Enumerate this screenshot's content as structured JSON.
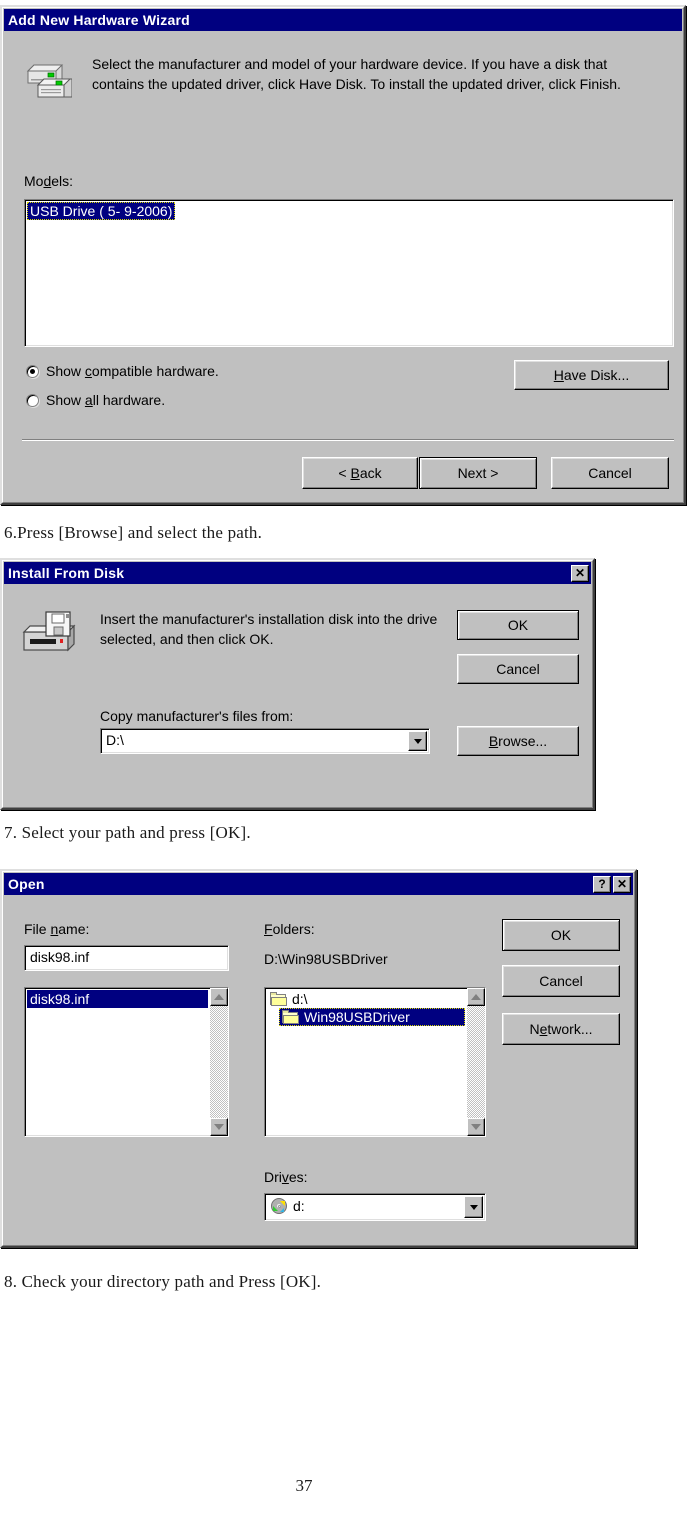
{
  "page": {
    "number": "37"
  },
  "steps": {
    "step6": "6.Press [Browse] and select the path.",
    "step7": "7. Select your path and press [OK].",
    "step8": "8. Check your directory path and Press [OK]."
  },
  "wizard": {
    "title": "Add New Hardware Wizard",
    "icon": "hardware-devices-icon",
    "instruction": "Select the manufacturer and model of your hardware device. If you have a disk that contains the updated driver, click Have Disk. To install the updated driver, click Finish.",
    "models_label": "Models:",
    "models": [
      {
        "label": "USB Drive ( 5- 9-2006)",
        "selected": true
      }
    ],
    "radios": [
      {
        "label_pre": "Show ",
        "accel": "c",
        "label_post": "ompatible hardware.",
        "checked": true
      },
      {
        "label_pre": "Show ",
        "accel": "a",
        "label_post": "ll hardware.",
        "checked": false
      }
    ],
    "have_disk_label_pre": "",
    "have_disk_accel": "H",
    "have_disk_label_post": "ave Disk...",
    "buttons": {
      "back_pre": "< ",
      "back_accel": "B",
      "back_post": "ack",
      "next": "Next >",
      "cancel": "Cancel"
    }
  },
  "install_from_disk": {
    "title": "Install From Disk",
    "close_glyph": "✕",
    "icon": "floppy-drive-icon",
    "message": "Insert the manufacturer's installation disk into the drive selected, and then click OK.",
    "copy_label": "Copy manufacturer's files from:",
    "path_value": "D:\\",
    "ok": "OK",
    "cancel": "Cancel",
    "browse_accel": "B",
    "browse_post": "rowse..."
  },
  "open_dialog": {
    "title": "Open",
    "help_glyph": "?",
    "close_glyph": "✕",
    "file_name_label_pre": "File ",
    "file_name_accel": "n",
    "file_name_label_post": "ame:",
    "file_name_value": "disk98.inf",
    "file_list": [
      {
        "label": "disk98.inf",
        "selected": true
      }
    ],
    "folders_label_pre": "",
    "folders_accel": "F",
    "folders_label_post": "olders:",
    "current_path": "D:\\Win98USBDriver",
    "folder_list": [
      {
        "label": "d:\\",
        "selected": false,
        "indent": 0,
        "icon": "open-folder-icon"
      },
      {
        "label": "Win98USBDriver",
        "selected": true,
        "indent": 1,
        "icon": "open-folder-icon"
      }
    ],
    "drives_label_pre": "Dri",
    "drives_accel": "v",
    "drives_label_post": "es:",
    "drive_value": "d:",
    "drive_icon": "cd-rom-icon",
    "buttons": {
      "ok": "OK",
      "cancel": "Cancel",
      "network_pre": "N",
      "network_accel": "e",
      "network_post": "twork..."
    }
  },
  "colors": {
    "titlebar": "#000080",
    "face": "#c0c0c0",
    "selection": "#000080"
  }
}
